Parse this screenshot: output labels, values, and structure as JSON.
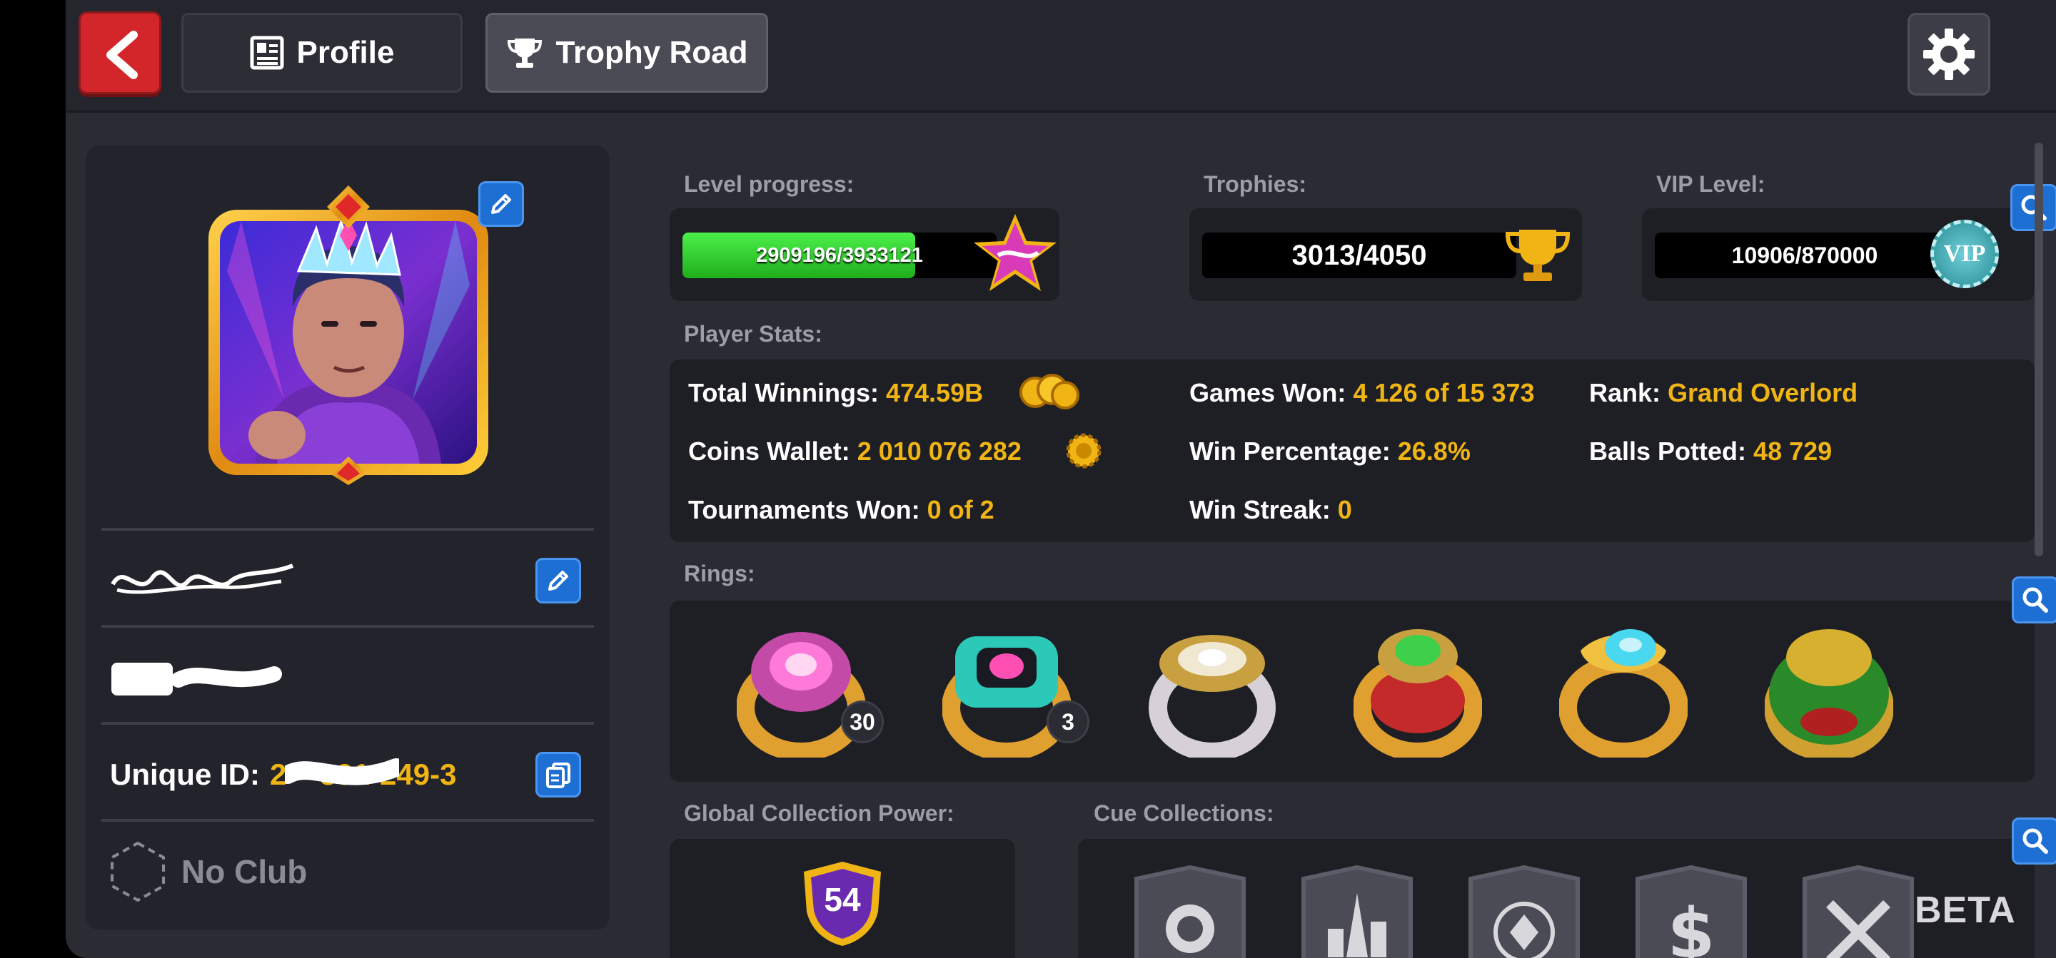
{
  "topbar": {
    "tabs": [
      {
        "label": "Profile"
      },
      {
        "label": "Trophy Road"
      }
    ]
  },
  "profile": {
    "unique_id_label": "Unique ID:",
    "unique_id_value": "2**-391-249-3",
    "club": "No Club"
  },
  "level": {
    "label": "Level progress:",
    "value_text": "2909196/3933121",
    "progress": 0.74
  },
  "trophies": {
    "label": "Trophies:",
    "value_text": "3013/4050"
  },
  "vip": {
    "label": "VIP Level:",
    "value_text": "10906/870000",
    "badge": "VIP"
  },
  "stats": {
    "label": "Player Stats:",
    "total_winnings_label": "Total Winnings:",
    "total_winnings_value": "474.59B",
    "coins_wallet_label": "Coins Wallet:",
    "coins_wallet_value": "2 010 076 282",
    "tournaments_won_label": "Tournaments Won:",
    "tournaments_won_value": "0 of 2",
    "games_won_label": "Games Won:",
    "games_won_value": "4 126 of 15 373",
    "win_percentage_label": "Win Percentage:",
    "win_percentage_value": "26.8%",
    "win_streak_label": "Win Streak:",
    "win_streak_value": "0",
    "rank_label": "Rank:",
    "rank_value": "Grand Overlord",
    "balls_potted_label": "Balls Potted:",
    "balls_potted_value": "48 729"
  },
  "rings": {
    "label": "Rings:",
    "ring_counts": [
      "30",
      "3"
    ]
  },
  "collection": {
    "label": "Global Collection Power:",
    "power": "54"
  },
  "cue_collections": {
    "label": "Cue Collections:"
  },
  "beta": "BETA",
  "colors": {
    "accent_gold": "#f0b514",
    "panel": "#23242b",
    "background": "#2a2b33",
    "progress_green": "#2fd12a",
    "back_red": "#d3262a",
    "button_blue": "#1e6fd4"
  }
}
